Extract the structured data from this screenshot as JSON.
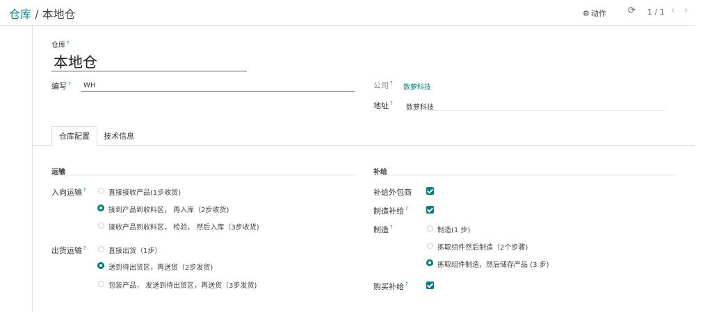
{
  "breadcrumb": {
    "parent": "仓库",
    "separator": " / ",
    "current": "本地仓"
  },
  "toolbar": {
    "actions_label": "动作",
    "pager": "1 / 1"
  },
  "form": {
    "name_label": "仓库",
    "name_value": "本地仓",
    "code_label": "编写",
    "code_value": "WH",
    "company_label": "公司",
    "company_value": "数萝科技",
    "address_label": "地址",
    "address_value": "数萝科技",
    "help_mark": "?"
  },
  "tabs": [
    {
      "label": "仓库配置",
      "active": true
    },
    {
      "label": "技术信息",
      "active": false
    }
  ],
  "shipping": {
    "title": "运输",
    "incoming_label": "入向运输",
    "incoming_options": [
      {
        "label": "直接接收产品(1步收货)",
        "selected": false
      },
      {
        "label": "接到产品到收料区， 再入库（2步收货)",
        "selected": true
      },
      {
        "label": "接收产品到收料区， 检验， 然后入库（3步收货)",
        "selected": false
      }
    ],
    "outgoing_label": "出货运输",
    "outgoing_options": [
      {
        "label": "直接出货（1步）",
        "selected": false
      },
      {
        "label": "送到待出货区，再送货（2步发货)",
        "selected": true
      },
      {
        "label": "包装产品， 发送到待出货区，再送货（3步发货)",
        "selected": false
      }
    ]
  },
  "replenish": {
    "title": "补给",
    "subcontract_label": "补给外包商",
    "subcontract_checked": true,
    "manufacture_label": "制造补给",
    "manufacture_checked": true,
    "mfg_steps_label": "制造",
    "mfg_options": [
      {
        "label": "制造(1 步)",
        "selected": false
      },
      {
        "label": "拣取组件然后制造（2个步骤)",
        "selected": false
      },
      {
        "label": "拣取组件制造，然后储存产品 (3 步)",
        "selected": true
      }
    ],
    "buy_label": "购买补给",
    "buy_checked": true
  },
  "colors": {
    "accent": "#017e84",
    "text": "#333333",
    "line": "#dddddd"
  },
  "icons": {
    "actions": "gear-icon",
    "refresh": "refresh-icon",
    "prev": "chevron-left-icon",
    "next": "chevron-right-icon"
  }
}
